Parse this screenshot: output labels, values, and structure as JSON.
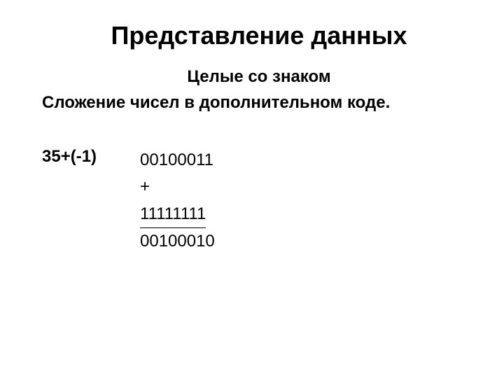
{
  "title": "Представление данных",
  "subtitle": "Целые со знаком",
  "description": "Сложение чисел в дополнительном коде.",
  "calculation": {
    "label": "35+(-1)",
    "line1": "00100011",
    "op": "+",
    "line2": "11111111",
    "result": "00100010"
  }
}
